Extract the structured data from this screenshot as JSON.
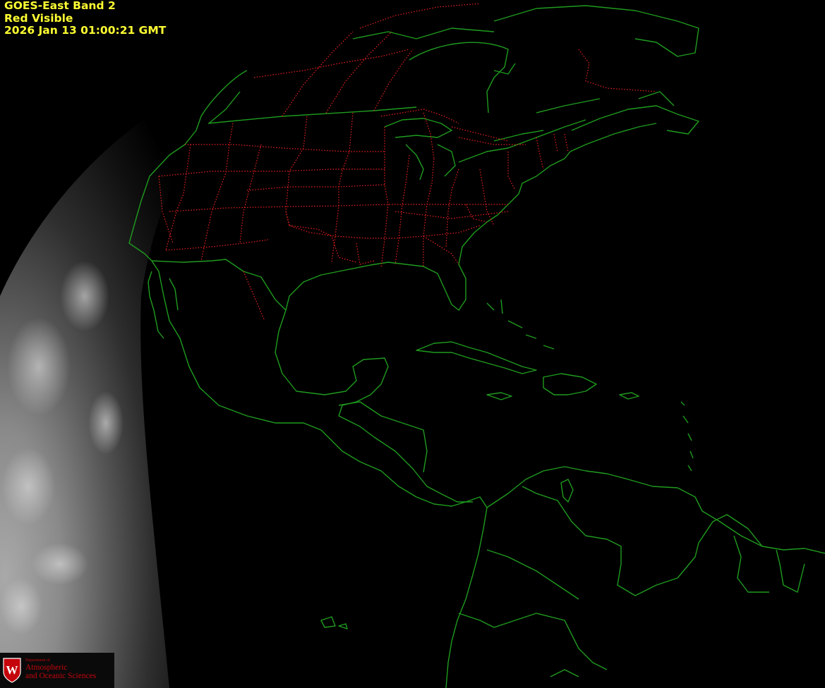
{
  "header": {
    "line1": "GOES-East Band 2",
    "line2": "Red Visible",
    "line3": "2026 Jan 13  01:00:21 GMT"
  },
  "logo": {
    "crest_letter": "W",
    "dept_label": "Department of",
    "line1": "Atmospheric",
    "line2": "and Oceanic Sciences"
  },
  "colors": {
    "background": "#000000",
    "header_text": "#ffff33",
    "coastline": "#1f9b1f",
    "state_borders": "#e0201f",
    "logo_red": "#c5050c"
  }
}
